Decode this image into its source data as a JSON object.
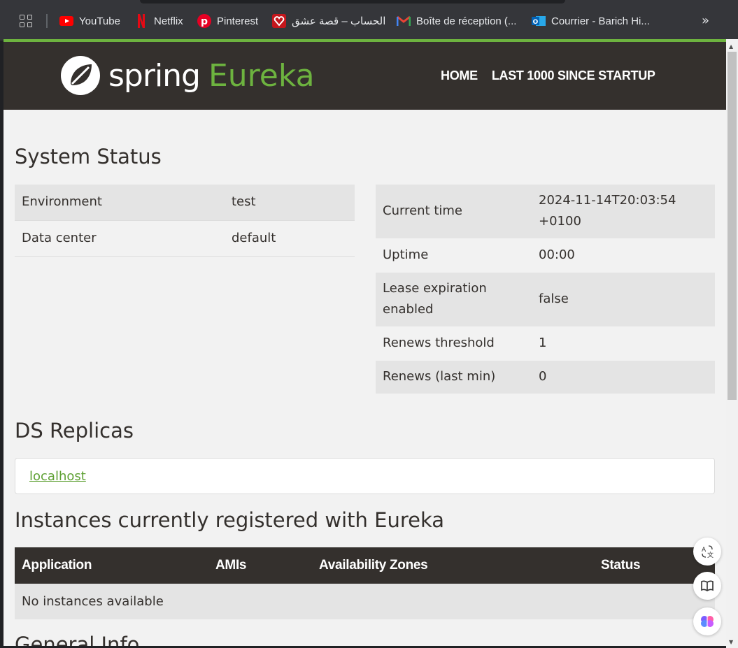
{
  "bookmarks": {
    "items": [
      {
        "label": "YouTube",
        "icon": "youtube-icon"
      },
      {
        "label": "Netflix",
        "icon": "netflix-icon"
      },
      {
        "label": "Pinterest",
        "icon": "pinterest-icon"
      },
      {
        "label": "الحساب – قصة عشق",
        "icon": "heart-icon"
      },
      {
        "label": "Boîte de réception (...",
        "icon": "gmail-icon"
      },
      {
        "label": "Courrier - Barich Hi...",
        "icon": "outlook-icon"
      }
    ],
    "more_label": "»"
  },
  "navbar": {
    "logo_spring": "spring",
    "logo_eureka": "Eureka",
    "links": [
      "HOME",
      "LAST 1000 SINCE STARTUP"
    ]
  },
  "system_status": {
    "title": "System Status",
    "left": [
      {
        "key": "Environment",
        "value": "test"
      },
      {
        "key": "Data center",
        "value": "default"
      }
    ],
    "right": [
      {
        "key": "Current time",
        "value": "2024-11-14T20:03:54 +0100"
      },
      {
        "key": "Uptime",
        "value": "00:00"
      },
      {
        "key": "Lease expiration enabled",
        "value": "false"
      },
      {
        "key": "Renews threshold",
        "value": "1"
      },
      {
        "key": "Renews (last min)",
        "value": "0"
      }
    ]
  },
  "ds_replicas": {
    "title": "DS Replicas",
    "link": "localhost"
  },
  "instances": {
    "title": "Instances currently registered with Eureka",
    "columns": [
      "Application",
      "AMIs",
      "Availability Zones",
      "Status"
    ],
    "empty_message": "No instances available"
  },
  "general_info": {
    "title": "General Info"
  },
  "colors": {
    "brand_green": "#6db33f",
    "navbar_bg": "#34302d"
  }
}
